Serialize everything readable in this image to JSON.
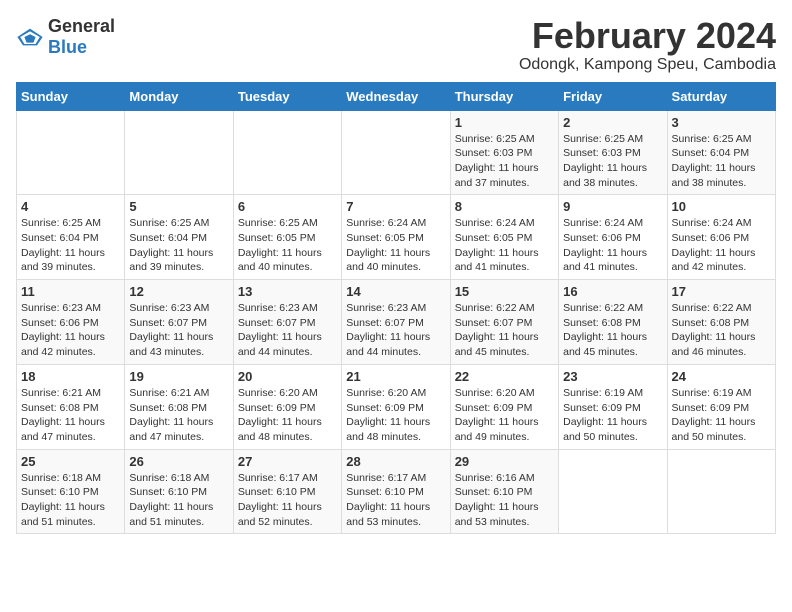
{
  "logo": {
    "text_general": "General",
    "text_blue": "Blue"
  },
  "title": "February 2024",
  "subtitle": "Odongk, Kampong Speu, Cambodia",
  "days_of_week": [
    "Sunday",
    "Monday",
    "Tuesday",
    "Wednesday",
    "Thursday",
    "Friday",
    "Saturday"
  ],
  "weeks": [
    [
      {
        "day": "",
        "info": ""
      },
      {
        "day": "",
        "info": ""
      },
      {
        "day": "",
        "info": ""
      },
      {
        "day": "",
        "info": ""
      },
      {
        "day": "1",
        "info": "Sunrise: 6:25 AM\nSunset: 6:03 PM\nDaylight: 11 hours\nand 37 minutes."
      },
      {
        "day": "2",
        "info": "Sunrise: 6:25 AM\nSunset: 6:03 PM\nDaylight: 11 hours\nand 38 minutes."
      },
      {
        "day": "3",
        "info": "Sunrise: 6:25 AM\nSunset: 6:04 PM\nDaylight: 11 hours\nand 38 minutes."
      }
    ],
    [
      {
        "day": "4",
        "info": "Sunrise: 6:25 AM\nSunset: 6:04 PM\nDaylight: 11 hours\nand 39 minutes."
      },
      {
        "day": "5",
        "info": "Sunrise: 6:25 AM\nSunset: 6:04 PM\nDaylight: 11 hours\nand 39 minutes."
      },
      {
        "day": "6",
        "info": "Sunrise: 6:25 AM\nSunset: 6:05 PM\nDaylight: 11 hours\nand 40 minutes."
      },
      {
        "day": "7",
        "info": "Sunrise: 6:24 AM\nSunset: 6:05 PM\nDaylight: 11 hours\nand 40 minutes."
      },
      {
        "day": "8",
        "info": "Sunrise: 6:24 AM\nSunset: 6:05 PM\nDaylight: 11 hours\nand 41 minutes."
      },
      {
        "day": "9",
        "info": "Sunrise: 6:24 AM\nSunset: 6:06 PM\nDaylight: 11 hours\nand 41 minutes."
      },
      {
        "day": "10",
        "info": "Sunrise: 6:24 AM\nSunset: 6:06 PM\nDaylight: 11 hours\nand 42 minutes."
      }
    ],
    [
      {
        "day": "11",
        "info": "Sunrise: 6:23 AM\nSunset: 6:06 PM\nDaylight: 11 hours\nand 42 minutes."
      },
      {
        "day": "12",
        "info": "Sunrise: 6:23 AM\nSunset: 6:07 PM\nDaylight: 11 hours\nand 43 minutes."
      },
      {
        "day": "13",
        "info": "Sunrise: 6:23 AM\nSunset: 6:07 PM\nDaylight: 11 hours\nand 44 minutes."
      },
      {
        "day": "14",
        "info": "Sunrise: 6:23 AM\nSunset: 6:07 PM\nDaylight: 11 hours\nand 44 minutes."
      },
      {
        "day": "15",
        "info": "Sunrise: 6:22 AM\nSunset: 6:07 PM\nDaylight: 11 hours\nand 45 minutes."
      },
      {
        "day": "16",
        "info": "Sunrise: 6:22 AM\nSunset: 6:08 PM\nDaylight: 11 hours\nand 45 minutes."
      },
      {
        "day": "17",
        "info": "Sunrise: 6:22 AM\nSunset: 6:08 PM\nDaylight: 11 hours\nand 46 minutes."
      }
    ],
    [
      {
        "day": "18",
        "info": "Sunrise: 6:21 AM\nSunset: 6:08 PM\nDaylight: 11 hours\nand 47 minutes."
      },
      {
        "day": "19",
        "info": "Sunrise: 6:21 AM\nSunset: 6:08 PM\nDaylight: 11 hours\nand 47 minutes."
      },
      {
        "day": "20",
        "info": "Sunrise: 6:20 AM\nSunset: 6:09 PM\nDaylight: 11 hours\nand 48 minutes."
      },
      {
        "day": "21",
        "info": "Sunrise: 6:20 AM\nSunset: 6:09 PM\nDaylight: 11 hours\nand 48 minutes."
      },
      {
        "day": "22",
        "info": "Sunrise: 6:20 AM\nSunset: 6:09 PM\nDaylight: 11 hours\nand 49 minutes."
      },
      {
        "day": "23",
        "info": "Sunrise: 6:19 AM\nSunset: 6:09 PM\nDaylight: 11 hours\nand 50 minutes."
      },
      {
        "day": "24",
        "info": "Sunrise: 6:19 AM\nSunset: 6:09 PM\nDaylight: 11 hours\nand 50 minutes."
      }
    ],
    [
      {
        "day": "25",
        "info": "Sunrise: 6:18 AM\nSunset: 6:10 PM\nDaylight: 11 hours\nand 51 minutes."
      },
      {
        "day": "26",
        "info": "Sunrise: 6:18 AM\nSunset: 6:10 PM\nDaylight: 11 hours\nand 51 minutes."
      },
      {
        "day": "27",
        "info": "Sunrise: 6:17 AM\nSunset: 6:10 PM\nDaylight: 11 hours\nand 52 minutes."
      },
      {
        "day": "28",
        "info": "Sunrise: 6:17 AM\nSunset: 6:10 PM\nDaylight: 11 hours\nand 53 minutes."
      },
      {
        "day": "29",
        "info": "Sunrise: 6:16 AM\nSunset: 6:10 PM\nDaylight: 11 hours\nand 53 minutes."
      },
      {
        "day": "",
        "info": ""
      },
      {
        "day": "",
        "info": ""
      }
    ]
  ]
}
